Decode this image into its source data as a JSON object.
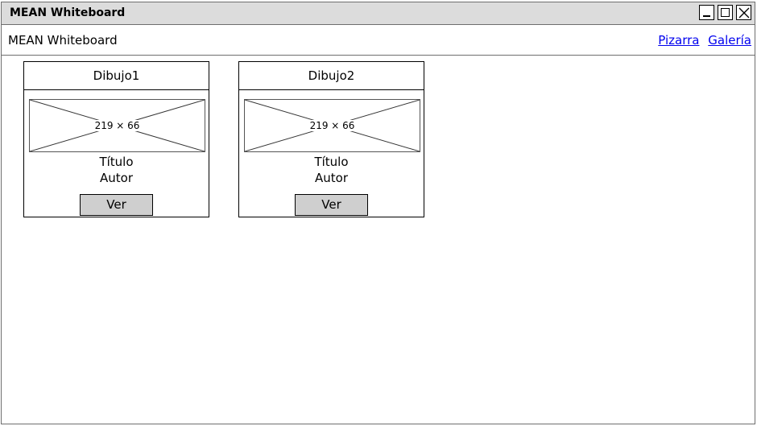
{
  "window": {
    "title": "MEAN Whiteboard"
  },
  "navbar": {
    "brand": "MEAN Whiteboard",
    "links": [
      "Pizarra",
      "Galería"
    ]
  },
  "cards": [
    {
      "header": "Dibujo1",
      "image_label": "219 × 66",
      "title": "Título",
      "author": "Autor",
      "button": "Ver"
    },
    {
      "header": "Dibujo2",
      "image_label": "219 × 66",
      "title": "Título",
      "author": "Autor",
      "button": "Ver"
    }
  ],
  "icons": {
    "minimize": "minimize-icon",
    "maximize": "maximize-icon",
    "close": "close-icon",
    "image_placeholder": "image-placeholder-icon"
  },
  "colors": {
    "titlebar": "#dcdcdc",
    "link": "#0000ee",
    "button": "#cfcfcf"
  }
}
